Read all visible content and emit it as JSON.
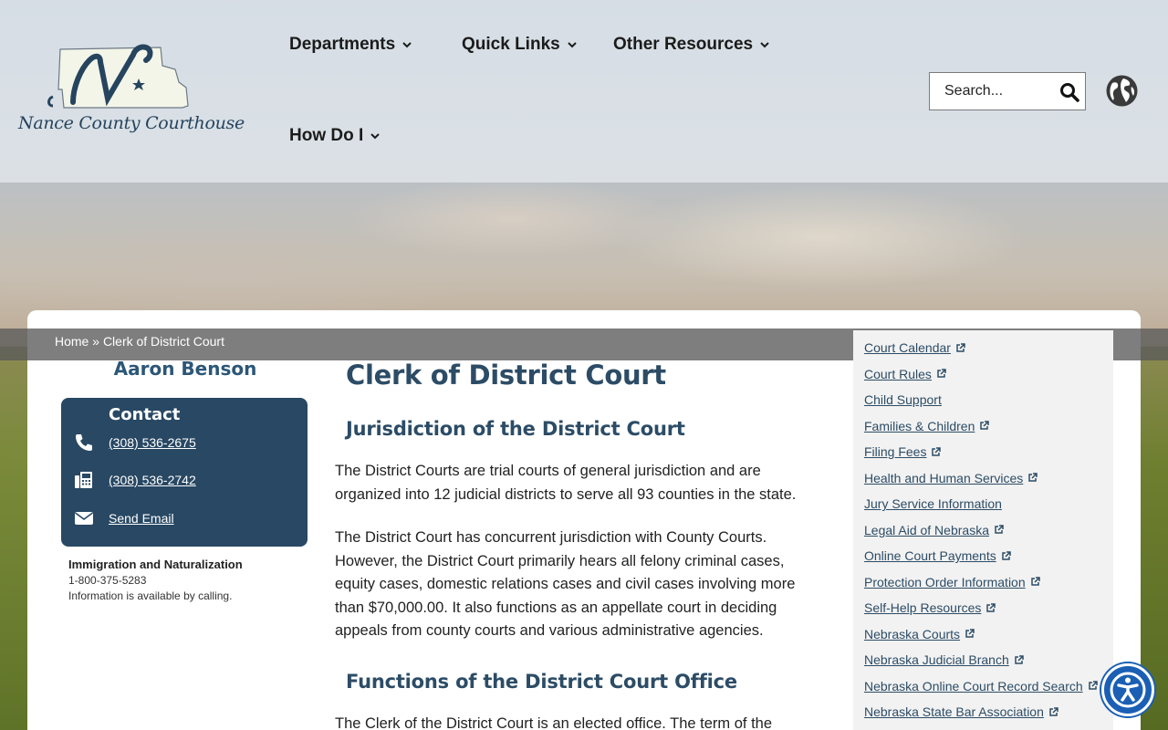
{
  "header": {
    "logo_text": "Nance County Courthouse",
    "nav": [
      {
        "label": "Departments"
      },
      {
        "label": "Quick Links"
      },
      {
        "label": "Other Resources"
      },
      {
        "label": "How Do I"
      }
    ],
    "search_placeholder": "Search..."
  },
  "breadcrumb": {
    "home": "Home",
    "separator": " » ",
    "current": "Clerk of District Court"
  },
  "left": {
    "name": "Aaron Benson",
    "contact_title": "Contact",
    "phone": "(308) 536-2675",
    "fax": "(308) 536-2742",
    "email_label": "Send Email",
    "immigration_title": "Immigration and Naturalization",
    "immigration_phone": "1-800-375-5283",
    "immigration_note": "Information is available by calling."
  },
  "main": {
    "title": "Clerk of District Court",
    "section1_heading": "Jurisdiction of the District Court",
    "para1": "The District Courts are trial courts of general jurisdiction and are organized into 12 judicial districts to serve all 93 counties in the state.",
    "para2": "The District Court has concurrent jurisdiction with County Courts. However, the District Court primarily hears all felony criminal cases, equity cases, domestic relations cases and civil cases involving more than $70,000.00. It also functions as an appellate court in deciding appeals from county courts and various administrative agencies.",
    "section2_heading": "Functions of the District Court Office",
    "para3": "The Clerk of the District Court is an elected office. The term of the"
  },
  "sidebar": {
    "links": [
      {
        "label": "Court Calendar",
        "external": true
      },
      {
        "label": "Court Rules",
        "external": true
      },
      {
        "label": "Child Support",
        "external": false
      },
      {
        "label": "Families & Children",
        "external": true
      },
      {
        "label": "Filing Fees",
        "external": true
      },
      {
        "label": "Health and Human Services",
        "external": true
      },
      {
        "label": "Jury Service Information",
        "external": false
      },
      {
        "label": "Legal Aid of Nebraska",
        "external": true
      },
      {
        "label": "Online Court Payments",
        "external": true
      },
      {
        "label": "Protection Order Information",
        "external": true
      },
      {
        "label": "Self-Help Resources",
        "external": true
      },
      {
        "label": "Nebraska Courts",
        "external": true
      },
      {
        "label": "Nebraska Judicial Branch",
        "external": true
      },
      {
        "label": "Nebraska Online Court Record Search",
        "external": true
      },
      {
        "label": "Nebraska State Bar Association",
        "external": true
      }
    ]
  },
  "icons": {
    "search": "search-icon",
    "globe": "globe-icon",
    "phone": "phone-icon",
    "fax": "fax-icon",
    "email": "envelope-icon",
    "external": "external-link-icon",
    "accessibility": "accessibility-icon"
  },
  "colors": {
    "brand_navy": "#284863",
    "heading": "#2c4c66",
    "accessibility_blue": "#1a5fb4"
  }
}
